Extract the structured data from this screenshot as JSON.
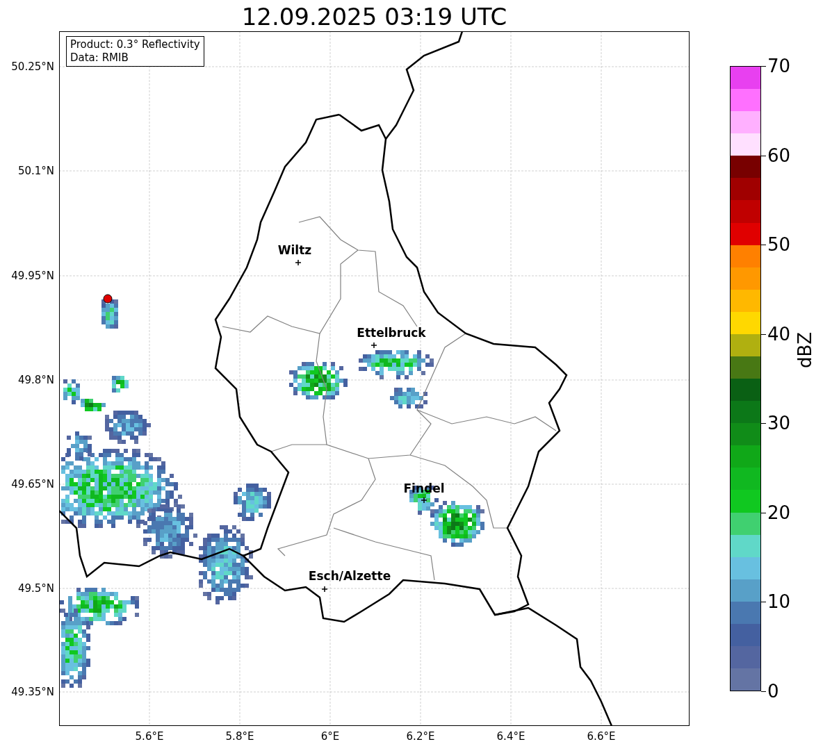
{
  "title": "12.09.2025 03:19 UTC",
  "info_box": {
    "lines": [
      "Product: 0.3° Reflectivity",
      "Data: RMIB"
    ]
  },
  "map": {
    "y_ticks": [
      "50.25°N",
      "50.1°N",
      "49.95°N",
      "49.8°N",
      "49.65°N",
      "49.5°N",
      "49.35°N"
    ],
    "x_ticks": [
      "5.6°E",
      "5.8°E",
      "6°E",
      "6.2°E",
      "6.4°E",
      "6.6°E"
    ],
    "cities": [
      {
        "name": "Wiltz"
      },
      {
        "name": "Ettelbruck"
      },
      {
        "name": "Findel"
      },
      {
        "name": "Esch/Alzette"
      }
    ]
  },
  "colorbar": {
    "label": "dBZ",
    "ticks": [
      "70",
      "60",
      "50",
      "40",
      "30",
      "20",
      "10",
      "0"
    ],
    "segments": [
      {
        "color": "#e840f0"
      },
      {
        "color": "#ff70ff"
      },
      {
        "color": "#ffb0ff"
      },
      {
        "color": "#ffe0ff"
      },
      {
        "color": "#780000"
      },
      {
        "color": "#a00000"
      },
      {
        "color": "#c00000"
      },
      {
        "color": "#e00000"
      },
      {
        "color": "#ff8000"
      },
      {
        "color": "#ff9800"
      },
      {
        "color": "#ffb800"
      },
      {
        "color": "#ffd800"
      },
      {
        "color": "#b0b010"
      },
      {
        "color": "#487814"
      },
      {
        "color": "#0a6014"
      },
      {
        "color": "#0c7818"
      },
      {
        "color": "#108c18"
      },
      {
        "color": "#10a818"
      },
      {
        "color": "#10b820"
      },
      {
        "color": "#10c820"
      },
      {
        "color": "#40d070"
      },
      {
        "color": "#60d8c8"
      },
      {
        "color": "#68c0e0"
      },
      {
        "color": "#58a0c8"
      },
      {
        "color": "#4a78b0"
      },
      {
        "color": "#4460a0"
      },
      {
        "color": "#5466a0"
      },
      {
        "color": "#6474a4"
      }
    ]
  }
}
